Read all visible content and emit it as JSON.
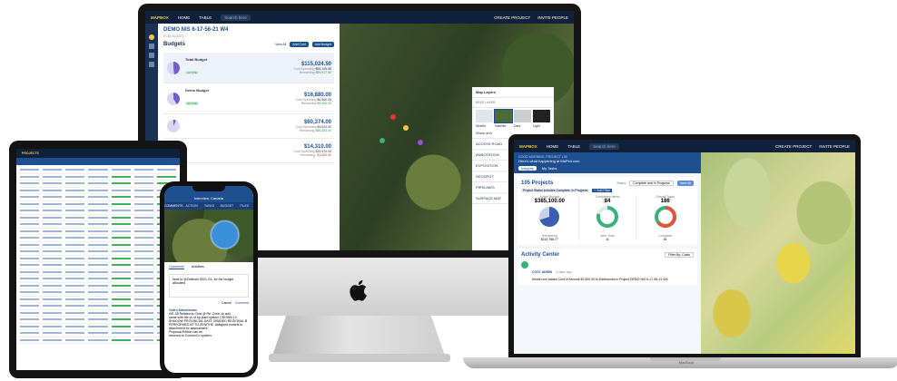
{
  "imac": {
    "topbar": {
      "brand": "MAPBOX",
      "home": "HOME",
      "table": "TABLE",
      "search_placeholder": "Search here",
      "create_project": "CREATE PROJECT",
      "invite_people": "INVITE PEOPLE"
    },
    "panel": {
      "title": "DEMO NIS 6-17-56-21 W4",
      "subtitle": "FCSL 50,8373",
      "section": "Budgets",
      "view_all": "View All",
      "add_cost": "Add Cost",
      "add_budget": "Add Budget",
      "budgets": [
        {
          "name": "Total Budget",
          "tag": "ACTIVE",
          "amount": "$115,024.50",
          "spent_label": "Cost Spending",
          "spent": "$55,109.56",
          "remaining_label": "Remaining",
          "remaining": "$59,917.90",
          "fill": 0.48
        },
        {
          "name": "Demo Budget",
          "tag": "ACTIVE",
          "amount": "$16,880.00",
          "spent_label": "Cost Spending",
          "spent": "$6,960.00",
          "remaining_label": "Remaining",
          "remaining": "$9,960.00",
          "fill": 0.41
        },
        {
          "name": "",
          "tag": "",
          "amount": "$60,374.00",
          "spent_label": "Cost Spending",
          "spent": "$4,020.00",
          "remaining_label": "Remaining",
          "remaining": "$56,354.00",
          "fill": 0.07
        },
        {
          "name": "",
          "tag": "",
          "amount": "$14,310.00",
          "spent_label": "Cost Spending",
          "spent": "$15,970.00",
          "remaining_label": "Remaining",
          "remaining": "-$1,660.00",
          "fill": 1.0
        }
      ]
    },
    "layers": {
      "title": "Map Layers",
      "base_label": "BASE LAYER",
      "base_options": [
        "Streets",
        "Satellite",
        "Dark",
        "Light"
      ],
      "show_label": "Show ann",
      "items": [
        "ACCESS ROAD",
        "ANNOTATION",
        "EXPOSITION",
        "GEOSPOT",
        "PIPELINES",
        "SURFACE MAT"
      ]
    }
  },
  "macbook": {
    "topbar": {
      "brand": "MAPBOX",
      "home": "HOME",
      "table": "TABLE",
      "search_placeholder": "Search here",
      "create_project": "CREATE PROJECT",
      "invite_people": "INVITE PEOPLE"
    },
    "banner": {
      "line1": "GOOD MORNING, PROJECT LIM",
      "line2": "Here's what happening at MaPlot.com",
      "insights": "Insights",
      "my_tasks": "My Tasks"
    },
    "projects": {
      "title": "105 Projects",
      "status_label": "Status",
      "filter_value": "Complete and In Progress",
      "view_all": "View All",
      "chip": "Project Status includes Complete, In Progress",
      "add_filter": "+ Add Filter",
      "stats": [
        {
          "label": "Active Budget",
          "value": "$385,100.00",
          "sub_label": "Remaining",
          "sub_value": "$113,768.77",
          "color": "#3a5fb0"
        },
        {
          "label": "Completed Items",
          "value": "84",
          "sub_label": "Item Total",
          "sub_value": "11",
          "color": "#3ab27a"
        },
        {
          "label": "Overall Tasks",
          "value": "186",
          "sub_label": "Complete",
          "sub_value": "81",
          "color": "#e2543b"
        }
      ]
    },
    "activity": {
      "title": "Activity Center",
      "filter": "Filter By: Costs",
      "author": "COST ADMIN",
      "time": "5 days ago",
      "text": "Kiewit.com added Cost of Amount $2,500.00 to Earthworks in Project DEMO NIS 6-17-56-21 W4"
    },
    "label": "MacBook"
  },
  "tablet": {
    "title": "PROJECTS",
    "rows": 26
  },
  "phone": {
    "title": "Interview, Canada",
    "tabs": [
      "COMMENTS",
      "ACTION",
      "TASKS",
      "BUDGET",
      "FILES"
    ],
    "sub_tabs": [
      "Comments",
      "Activities"
    ],
    "comment_input": "Note to @Zeitloser 8321-S1- for the budget allocated",
    "cancel": "Cancel",
    "comment_btn": "Comment",
    "author": "Vedro Kaloutemao",
    "feed": [
      "IVE-35 Related to Chat @ Re: Zone. to add",
      "same with the vs of by plant system CROWN 10",
      "SHADOW PROVINCIAL DATE GRADED REGIONAL B",
      "PERFORMED AT TO ZENITHE. Assigned models to",
      "Attachment for assessment.",
      "Proposal Edition can be",
      "returned to ConnexCo system."
    ]
  }
}
